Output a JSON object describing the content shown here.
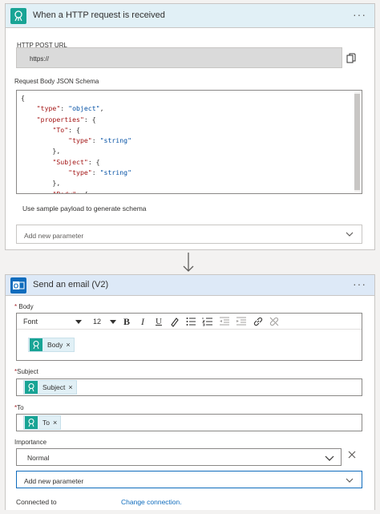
{
  "trigger": {
    "title": "When a HTTP request is received",
    "more_label": "···",
    "icon": "http-request-icon",
    "url_label": "HTTP POST URL",
    "url_value": "https://",
    "copy_icon": "copy-icon",
    "schema_label": "Request Body JSON Schema",
    "schema_lines": [
      "{",
      "    \"type\": \"object\",",
      "    \"properties\": {",
      "        \"To\": {",
      "            \"type\": \"string\"",
      "        },",
      "        \"Subject\": {",
      "            \"type\": \"string\"",
      "        },",
      "        \"Body\": {"
    ],
    "sample_payload_link": "Use sample payload to generate schema",
    "add_parameter": "Add new parameter"
  },
  "action": {
    "title": "Send an email (V2)",
    "more_label": "···",
    "icon": "outlook-icon",
    "body_label": "Body",
    "required_mark": "*",
    "toolbar": {
      "font": "Font",
      "size": "12",
      "buttons": [
        "bold",
        "italic",
        "underline",
        "highlight",
        "bullet-list",
        "numbered-list",
        "decrease-indent",
        "increase-indent",
        "link",
        "unlink"
      ]
    },
    "body_token": "Body",
    "subject_label": "Subject",
    "subject_token": "Subject",
    "to_label": "To",
    "to_token": "To",
    "token_remove": "×",
    "importance_label": "Importance",
    "importance_value": "Normal",
    "add_parameter": "Add new parameter",
    "connected_label": "Connected to",
    "change_connection": "Change connection."
  },
  "colors": {
    "trigger_accent": "#18a495",
    "action_accent": "#0f6cbd",
    "required": "#a4262c",
    "link": "#0f6cbd"
  }
}
